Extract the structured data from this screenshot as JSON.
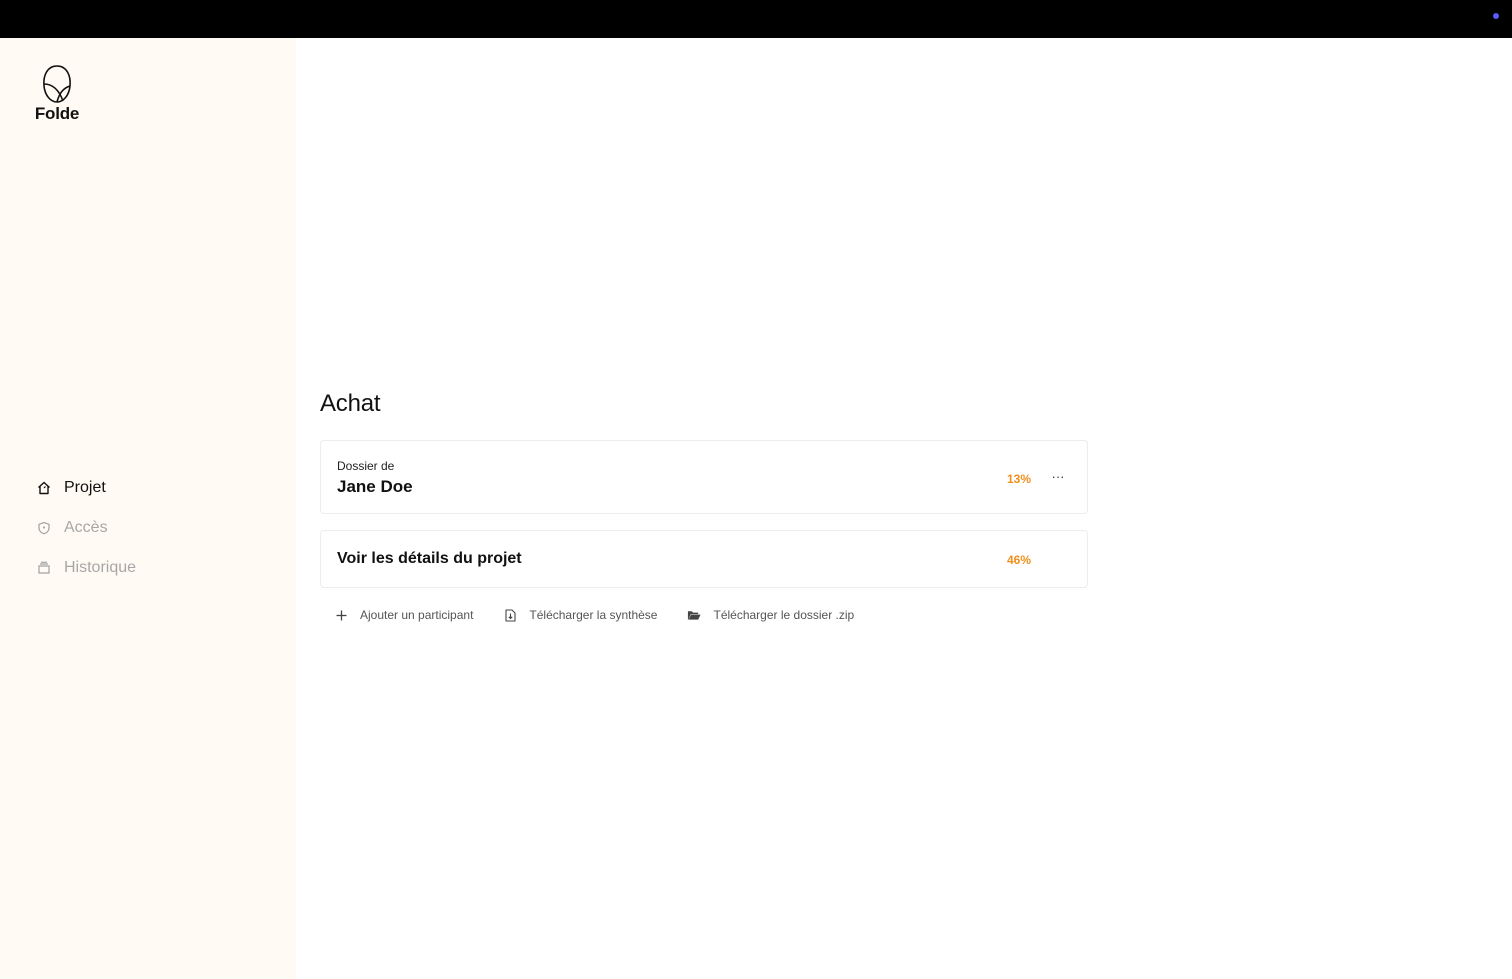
{
  "brand": {
    "name": "Folde"
  },
  "sidebar": {
    "items": [
      {
        "label": "Projet",
        "icon": "home-icon",
        "active": true
      },
      {
        "label": "Accès",
        "icon": "shield-icon",
        "active": false
      },
      {
        "label": "Historique",
        "icon": "archive-icon",
        "active": false
      }
    ]
  },
  "main": {
    "title": "Achat",
    "dossier": {
      "caption": "Dossier de",
      "name": "Jane Doe",
      "progress": "13%",
      "more_label": "···"
    },
    "details": {
      "label": "Voir les détails du projet",
      "progress": "46%"
    },
    "actions": [
      {
        "label": "Ajouter un participant",
        "icon": "plus-icon"
      },
      {
        "label": "Télécharger la synthèse",
        "icon": "file-download-icon"
      },
      {
        "label": "Télécharger le dossier .zip",
        "icon": "folder-open-icon"
      }
    ]
  },
  "colors": {
    "topbar": "#000000",
    "sidebar_bg": "#fffaf3",
    "accent_progress": "#f0901c",
    "status_dot": "#5b5bff"
  }
}
